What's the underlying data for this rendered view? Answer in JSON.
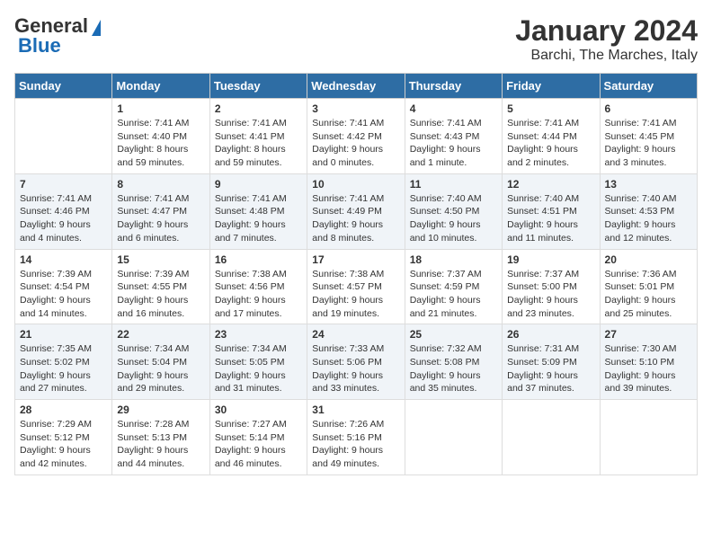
{
  "header": {
    "logo_general": "General",
    "logo_blue": "Blue",
    "title": "January 2024",
    "subtitle": "Barchi, The Marches, Italy"
  },
  "calendar": {
    "days_of_week": [
      "Sunday",
      "Monday",
      "Tuesday",
      "Wednesday",
      "Thursday",
      "Friday",
      "Saturday"
    ],
    "weeks": [
      [
        {
          "day": "",
          "content": ""
        },
        {
          "day": "1",
          "content": "Sunrise: 7:41 AM\nSunset: 4:40 PM\nDaylight: 8 hours\nand 59 minutes."
        },
        {
          "day": "2",
          "content": "Sunrise: 7:41 AM\nSunset: 4:41 PM\nDaylight: 8 hours\nand 59 minutes."
        },
        {
          "day": "3",
          "content": "Sunrise: 7:41 AM\nSunset: 4:42 PM\nDaylight: 9 hours\nand 0 minutes."
        },
        {
          "day": "4",
          "content": "Sunrise: 7:41 AM\nSunset: 4:43 PM\nDaylight: 9 hours\nand 1 minute."
        },
        {
          "day": "5",
          "content": "Sunrise: 7:41 AM\nSunset: 4:44 PM\nDaylight: 9 hours\nand 2 minutes."
        },
        {
          "day": "6",
          "content": "Sunrise: 7:41 AM\nSunset: 4:45 PM\nDaylight: 9 hours\nand 3 minutes."
        }
      ],
      [
        {
          "day": "7",
          "content": "Sunrise: 7:41 AM\nSunset: 4:46 PM\nDaylight: 9 hours\nand 4 minutes."
        },
        {
          "day": "8",
          "content": "Sunrise: 7:41 AM\nSunset: 4:47 PM\nDaylight: 9 hours\nand 6 minutes."
        },
        {
          "day": "9",
          "content": "Sunrise: 7:41 AM\nSunset: 4:48 PM\nDaylight: 9 hours\nand 7 minutes."
        },
        {
          "day": "10",
          "content": "Sunrise: 7:41 AM\nSunset: 4:49 PM\nDaylight: 9 hours\nand 8 minutes."
        },
        {
          "day": "11",
          "content": "Sunrise: 7:40 AM\nSunset: 4:50 PM\nDaylight: 9 hours\nand 10 minutes."
        },
        {
          "day": "12",
          "content": "Sunrise: 7:40 AM\nSunset: 4:51 PM\nDaylight: 9 hours\nand 11 minutes."
        },
        {
          "day": "13",
          "content": "Sunrise: 7:40 AM\nSunset: 4:53 PM\nDaylight: 9 hours\nand 12 minutes."
        }
      ],
      [
        {
          "day": "14",
          "content": "Sunrise: 7:39 AM\nSunset: 4:54 PM\nDaylight: 9 hours\nand 14 minutes."
        },
        {
          "day": "15",
          "content": "Sunrise: 7:39 AM\nSunset: 4:55 PM\nDaylight: 9 hours\nand 16 minutes."
        },
        {
          "day": "16",
          "content": "Sunrise: 7:38 AM\nSunset: 4:56 PM\nDaylight: 9 hours\nand 17 minutes."
        },
        {
          "day": "17",
          "content": "Sunrise: 7:38 AM\nSunset: 4:57 PM\nDaylight: 9 hours\nand 19 minutes."
        },
        {
          "day": "18",
          "content": "Sunrise: 7:37 AM\nSunset: 4:59 PM\nDaylight: 9 hours\nand 21 minutes."
        },
        {
          "day": "19",
          "content": "Sunrise: 7:37 AM\nSunset: 5:00 PM\nDaylight: 9 hours\nand 23 minutes."
        },
        {
          "day": "20",
          "content": "Sunrise: 7:36 AM\nSunset: 5:01 PM\nDaylight: 9 hours\nand 25 minutes."
        }
      ],
      [
        {
          "day": "21",
          "content": "Sunrise: 7:35 AM\nSunset: 5:02 PM\nDaylight: 9 hours\nand 27 minutes."
        },
        {
          "day": "22",
          "content": "Sunrise: 7:34 AM\nSunset: 5:04 PM\nDaylight: 9 hours\nand 29 minutes."
        },
        {
          "day": "23",
          "content": "Sunrise: 7:34 AM\nSunset: 5:05 PM\nDaylight: 9 hours\nand 31 minutes."
        },
        {
          "day": "24",
          "content": "Sunrise: 7:33 AM\nSunset: 5:06 PM\nDaylight: 9 hours\nand 33 minutes."
        },
        {
          "day": "25",
          "content": "Sunrise: 7:32 AM\nSunset: 5:08 PM\nDaylight: 9 hours\nand 35 minutes."
        },
        {
          "day": "26",
          "content": "Sunrise: 7:31 AM\nSunset: 5:09 PM\nDaylight: 9 hours\nand 37 minutes."
        },
        {
          "day": "27",
          "content": "Sunrise: 7:30 AM\nSunset: 5:10 PM\nDaylight: 9 hours\nand 39 minutes."
        }
      ],
      [
        {
          "day": "28",
          "content": "Sunrise: 7:29 AM\nSunset: 5:12 PM\nDaylight: 9 hours\nand 42 minutes."
        },
        {
          "day": "29",
          "content": "Sunrise: 7:28 AM\nSunset: 5:13 PM\nDaylight: 9 hours\nand 44 minutes."
        },
        {
          "day": "30",
          "content": "Sunrise: 7:27 AM\nSunset: 5:14 PM\nDaylight: 9 hours\nand 46 minutes."
        },
        {
          "day": "31",
          "content": "Sunrise: 7:26 AM\nSunset: 5:16 PM\nDaylight: 9 hours\nand 49 minutes."
        },
        {
          "day": "",
          "content": ""
        },
        {
          "day": "",
          "content": ""
        },
        {
          "day": "",
          "content": ""
        }
      ]
    ]
  }
}
